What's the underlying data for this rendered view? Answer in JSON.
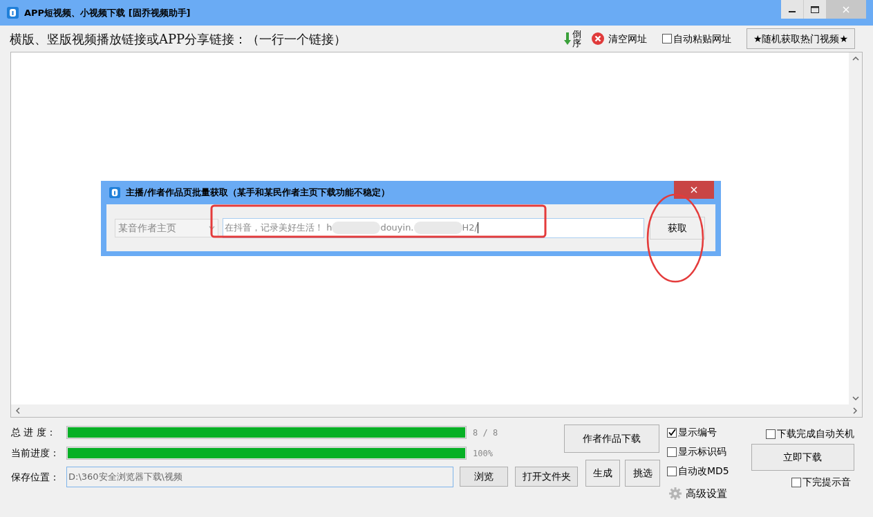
{
  "window": {
    "title": "APP短视频、小视频下载 [固乔视频助手]"
  },
  "toolbar": {
    "prompt": "横版、竖版视频播放链接或APP分享链接：（一行一个链接）",
    "reverse": "倒序",
    "clear": "清空网址",
    "auto_paste": {
      "label": "自动粘贴网址",
      "checked": false
    },
    "random_button": "★随机获取热门视频★"
  },
  "dialog": {
    "title": "主播/作者作品页批量获取（某手和某民作者主页下载功能不稳定）",
    "source": "某音作者主页",
    "url_parts": [
      "在抖音，记录美好生活！ h",
      "douyin.",
      "H2/"
    ],
    "fetch_button": "获取"
  },
  "progress": [
    {
      "label": "总 进 度：",
      "level": 1,
      "reading": "8 / 8"
    },
    {
      "label": "当前进度：",
      "level": 1,
      "reading": "100%"
    }
  ],
  "save": {
    "label": "保存位置：",
    "value": "D:\\360安全浏览器下载\\视频",
    "browse": "浏览",
    "open_folder": "打开文件夹"
  },
  "buttons": {
    "author_download": "作者作品下载",
    "generate": "生成",
    "pick": "挑选",
    "download_now": "立即下载"
  },
  "options": [
    {
      "label": "显示编号",
      "checked": true
    },
    {
      "label": "显示标识码",
      "checked": false
    },
    {
      "label": "自动改MD5",
      "checked": false
    }
  ],
  "advanced": "高级设置",
  "shutdown": {
    "label": "下载完成自动关机",
    "checked": false
  },
  "sound": {
    "label": "下完提示音",
    "checked": false
  }
}
